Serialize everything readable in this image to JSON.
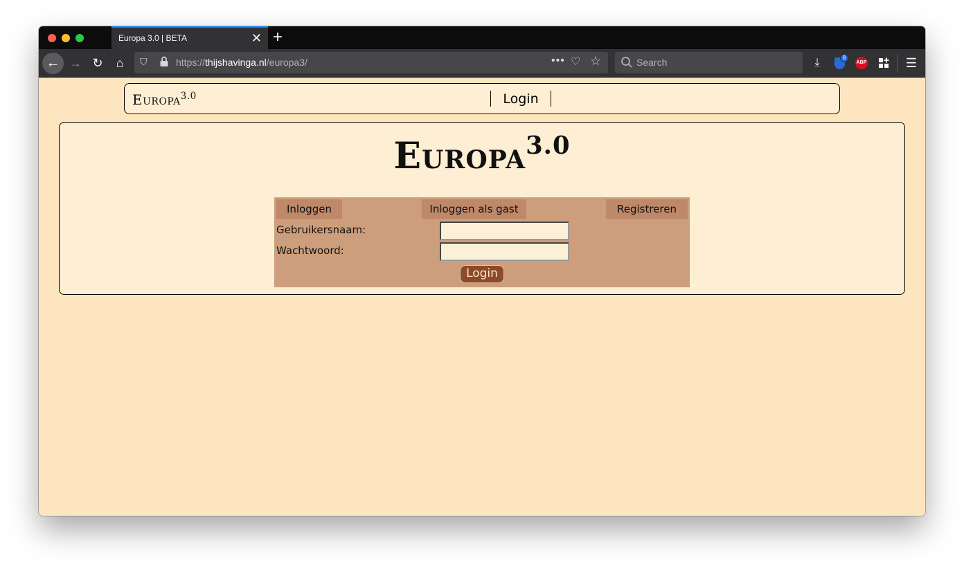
{
  "browser": {
    "tab_title": "Europa 3.0 | BETA",
    "url_scheme": "https://",
    "url_host": "thijshavinga.nl",
    "url_path": "/europa3/",
    "search_placeholder": "Search",
    "ublock_badge": "8",
    "abp_label": "ABP"
  },
  "site_nav": {
    "logo_text": "Europa",
    "logo_version": "3.0",
    "login_link": "Login"
  },
  "main": {
    "logo_text": "Europa",
    "logo_version": "3.0"
  },
  "login_form": {
    "tabs": [
      "Inloggen",
      "Inloggen als gast",
      "Registreren"
    ],
    "username_label": "Gebruikersnaam:",
    "password_label": "Wachtwoord:",
    "username_value": "",
    "password_value": "",
    "submit_label": "Login"
  },
  "colors": {
    "page_bg": "#fde5bf",
    "panel_bg": "#feefd4",
    "form_bg": "#cc9e7c",
    "tab_bg": "#bf8868",
    "button_bg": "#8d4a2b"
  }
}
